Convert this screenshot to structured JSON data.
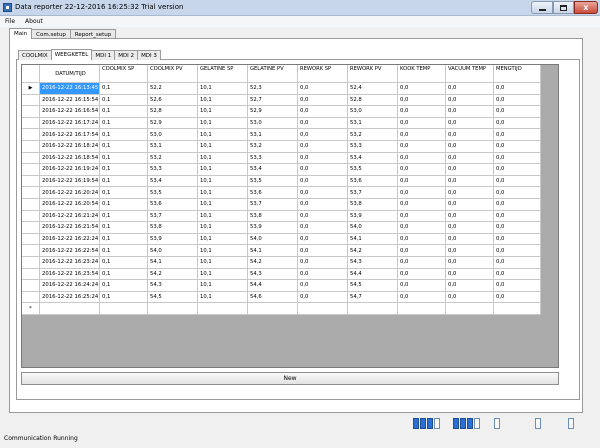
{
  "window": {
    "title": "Data reporter 22-12-2016 16:25:32 Trial version",
    "minimize": "minimize",
    "maximize": "maximize",
    "close": "x"
  },
  "menu": [
    "File",
    "About"
  ],
  "outer_tabs": [
    {
      "label": "Main",
      "active": true
    },
    {
      "label": "Com.setup",
      "active": false
    },
    {
      "label": "Report_setup",
      "active": false
    }
  ],
  "inner_tabs": [
    {
      "label": "COOLMIX",
      "active": false
    },
    {
      "label": "WEEGKETEL",
      "active": true
    },
    {
      "label": "MDI 1",
      "active": false
    },
    {
      "label": "MDI 2",
      "active": false
    },
    {
      "label": "MDI 3",
      "active": false
    }
  ],
  "grid": {
    "columns": [
      "DATUM/TIJD",
      "COOLMIX SP",
      "COOLMIX PV",
      "GELATINE SP",
      "GELATINE PV",
      "REWORK SP",
      "REWORK PV",
      "KOOK TEMP",
      "VACUUM TEMP",
      "MENGTIJD"
    ],
    "current_row_marker": "▶",
    "new_row_marker": "*",
    "rows": [
      [
        "2016-12-22 16:13:45",
        "0,1",
        "52,2",
        "10,1",
        "52,3",
        "0,0",
        "52,4",
        "0,0",
        "0,0",
        "0,0"
      ],
      [
        "2016-12-22 16:15:54",
        "0,1",
        "52,6",
        "10,1",
        "52,7",
        "0,0",
        "52,8",
        "0,0",
        "0,0",
        "0,0"
      ],
      [
        "2016-12-22 16:16:54",
        "0,1",
        "52,8",
        "10,1",
        "52,9",
        "0,0",
        "53,0",
        "0,0",
        "0,0",
        "0,0"
      ],
      [
        "2016-12-22 16:17:24",
        "0,1",
        "52,9",
        "10,1",
        "53,0",
        "0,0",
        "53,1",
        "0,0",
        "0,0",
        "0,0"
      ],
      [
        "2016-12-22 16:17:54",
        "0,1",
        "53,0",
        "10,1",
        "53,1",
        "0,0",
        "53,2",
        "0,0",
        "0,0",
        "0,0"
      ],
      [
        "2016-12-22 16:18:24",
        "0,1",
        "53,1",
        "10,1",
        "53,2",
        "0,0",
        "53,3",
        "0,0",
        "0,0",
        "0,0"
      ],
      [
        "2016-12-22 16:18:54",
        "0,1",
        "53,2",
        "10,1",
        "53,3",
        "0,0",
        "53,4",
        "0,0",
        "0,0",
        "0,0"
      ],
      [
        "2016-12-22 16:19:24",
        "0,1",
        "53,3",
        "10,1",
        "53,4",
        "0,0",
        "53,5",
        "0,0",
        "0,0",
        "0,0"
      ],
      [
        "2016-12-22 16:19:54",
        "0,1",
        "53,4",
        "10,1",
        "53,5",
        "0,0",
        "53,6",
        "0,0",
        "0,0",
        "0,0"
      ],
      [
        "2016-12-22 16:20:24",
        "0,1",
        "53,5",
        "10,1",
        "53,6",
        "0,0",
        "53,7",
        "0,0",
        "0,0",
        "0,0"
      ],
      [
        "2016-12-22 16:20:54",
        "0,1",
        "53,6",
        "10,1",
        "53,7",
        "0,0",
        "53,8",
        "0,0",
        "0,0",
        "0,0"
      ],
      [
        "2016-12-22 16:21:24",
        "0,1",
        "53,7",
        "10,1",
        "53,8",
        "0,0",
        "53,9",
        "0,0",
        "0,0",
        "0,0"
      ],
      [
        "2016-12-22 16:21:54",
        "0,1",
        "53,8",
        "10,1",
        "53,9",
        "0,0",
        "54,0",
        "0,0",
        "0,0",
        "0,0"
      ],
      [
        "2016-12-22 16:22:24",
        "0,1",
        "53,9",
        "10,1",
        "54,0",
        "0,0",
        "54,1",
        "0,0",
        "0,0",
        "0,0"
      ],
      [
        "2016-12-22 16:22:54",
        "0,1",
        "54,0",
        "10,1",
        "54,1",
        "0,0",
        "54,2",
        "0,0",
        "0,0",
        "0,0"
      ],
      [
        "2016-12-22 16:23:24",
        "0,1",
        "54,1",
        "10,1",
        "54,2",
        "0,0",
        "54,3",
        "0,0",
        "0,0",
        "0,0"
      ],
      [
        "2016-12-22 16:23:54",
        "0,1",
        "54,2",
        "10,1",
        "54,3",
        "0,0",
        "54,4",
        "0,0",
        "0,0",
        "0,0"
      ],
      [
        "2016-12-22 16:24:24",
        "0,1",
        "54,3",
        "10,1",
        "54,4",
        "0,0",
        "54,5",
        "0,0",
        "0,0",
        "0,0"
      ],
      [
        "2016-12-22 16:25:24",
        "0,1",
        "54,5",
        "10,1",
        "54,6",
        "0,0",
        "54,7",
        "0,0",
        "0,0",
        "0,0"
      ]
    ]
  },
  "new_button": "New",
  "status": {
    "text": "Communication Running",
    "indicators": [
      [
        true,
        true,
        true,
        false
      ],
      [
        true,
        true,
        true,
        false
      ],
      [
        false
      ],
      [
        false
      ],
      [
        false
      ]
    ]
  },
  "colors": {
    "selection": "#3399ff",
    "indicator_on": "#2d6fd0"
  }
}
